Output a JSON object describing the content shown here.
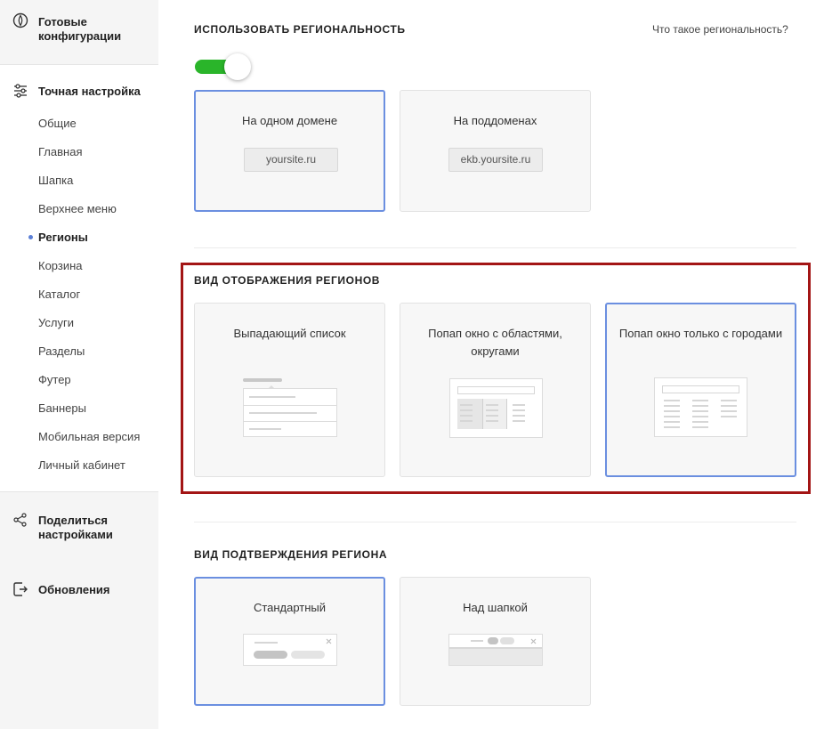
{
  "sidebar": {
    "presets_label": "Готовые конфигурации",
    "fine_tuning_label": "Точная настройка",
    "items": [
      "Общие",
      "Главная",
      "Шапка",
      "Верхнее меню",
      "Регионы",
      "Корзина",
      "Каталог",
      "Услуги",
      "Разделы",
      "Футер",
      "Баннеры",
      "Мобильная версия",
      "Личный кабинет"
    ],
    "active_item": "Регионы",
    "share_label": "Поделиться настройками",
    "updates_label": "Обновления",
    "icons": [
      "preset-config-icon",
      "sliders-icon",
      "share-icon",
      "update-icon"
    ]
  },
  "regionality": {
    "title": "ИСПОЛЬЗОВАТЬ РЕГИОНАЛЬНОСТЬ",
    "help_link": "Что такое региональность?",
    "toggle_on": true,
    "options": [
      {
        "label": "На одном домене",
        "example": "yoursite.ru",
        "selected": true
      },
      {
        "label": "На поддоменах",
        "example": "ekb.yoursite.ru",
        "selected": false
      }
    ]
  },
  "display": {
    "title": "ВИД ОТОБРАЖЕНИЯ РЕГИОНОВ",
    "options": [
      {
        "label": "Выпадающий список",
        "selected": false
      },
      {
        "label": "Попап окно с областями, округами",
        "selected": false
      },
      {
        "label": "Попап окно только с городами",
        "selected": true
      }
    ]
  },
  "confirm": {
    "title": "ВИД ПОДТВЕРЖДЕНИЯ РЕГИОНА",
    "options": [
      {
        "label": "Стандартный",
        "selected": true
      },
      {
        "label": "Над шапкой",
        "selected": false
      }
    ]
  },
  "colors": {
    "accent": "#6b8fe0",
    "toggle": "#2ab52a",
    "highlight": "#a31515"
  }
}
